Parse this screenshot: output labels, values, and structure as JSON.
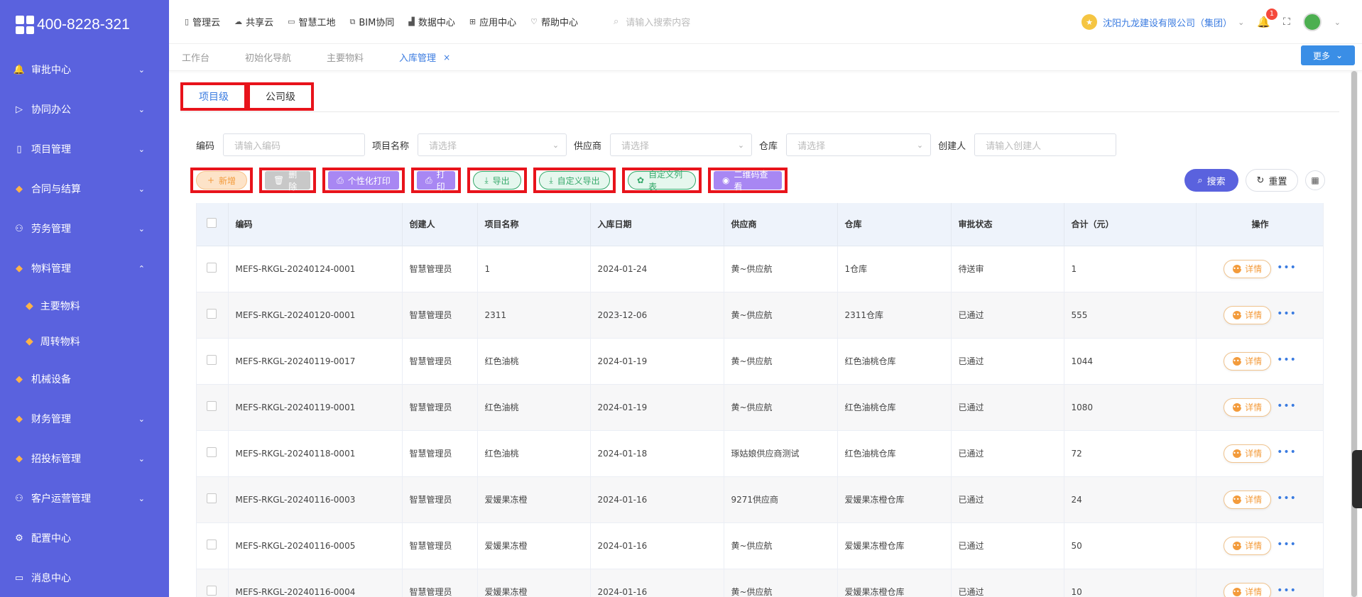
{
  "logo": {
    "text": "400-8228-321"
  },
  "sidebar": {
    "items": [
      {
        "icon": "bell-icon",
        "glyph": "🔔",
        "label": "审批中心",
        "chev": "⌄"
      },
      {
        "icon": "send-icon",
        "glyph": "▷",
        "label": "协同办公",
        "chev": "⌄"
      },
      {
        "icon": "book-icon",
        "glyph": "▯",
        "label": "项目管理",
        "chev": "⌄"
      },
      {
        "icon": "diamond-icon",
        "glyph": "◆",
        "label": "合同与结算",
        "chev": "⌄"
      },
      {
        "icon": "user-icon",
        "glyph": "⚇",
        "label": "劳务管理",
        "chev": "⌄"
      },
      {
        "icon": "diamond-icon",
        "glyph": "◆",
        "label": "物料管理",
        "chev": "⌃"
      }
    ],
    "sub_items": [
      {
        "icon": "diamond-icon",
        "glyph": "◆",
        "label": "主要物料"
      },
      {
        "icon": "diamond-icon",
        "glyph": "◆",
        "label": "周转物料"
      }
    ],
    "items_after": [
      {
        "icon": "diamond-icon",
        "glyph": "◆",
        "label": "机械设备",
        "chev": ""
      },
      {
        "icon": "diamond-icon",
        "glyph": "◆",
        "label": "财务管理",
        "chev": "⌄"
      },
      {
        "icon": "diamond-icon",
        "glyph": "◆",
        "label": "招投标管理",
        "chev": "⌄"
      },
      {
        "icon": "user-icon",
        "glyph": "⚇",
        "label": "客户运营管理",
        "chev": "⌄"
      },
      {
        "icon": "gear-icon",
        "glyph": "⚙",
        "label": "配置中心",
        "chev": ""
      },
      {
        "icon": "message-icon",
        "glyph": "▭",
        "label": "消息中心",
        "chev": ""
      }
    ]
  },
  "topnav": [
    {
      "icon": "book-icon",
      "glyph": "▯",
      "label": "管理云"
    },
    {
      "icon": "cloud-icon",
      "glyph": "☁",
      "label": "共享云"
    },
    {
      "icon": "monitor-icon",
      "glyph": "▭",
      "label": "智慧工地"
    },
    {
      "icon": "building-icon",
      "glyph": "⧉",
      "label": "BIM协同"
    },
    {
      "icon": "chart-icon",
      "glyph": "▟",
      "label": "数据中心"
    },
    {
      "icon": "apps-icon",
      "glyph": "⊞",
      "label": "应用中心"
    },
    {
      "icon": "help-icon",
      "glyph": "♡",
      "label": "帮助中心"
    }
  ],
  "top_search": {
    "placeholder": "请输入搜索内容"
  },
  "header": {
    "company": "沈阳九龙建设有限公司（集团）",
    "notification_count": "1"
  },
  "tabs": [
    {
      "label": "工作台",
      "active": false
    },
    {
      "label": "初始化导航",
      "active": false
    },
    {
      "label": "主要物料",
      "active": false
    },
    {
      "label": "入库管理",
      "active": true,
      "close": "×"
    }
  ],
  "more_button": "更多",
  "level_tabs": [
    "项目级",
    "公司级"
  ],
  "filters": {
    "code_label": "编码",
    "code_placeholder": "请输入编码",
    "project_label": "项目名称",
    "project_placeholder": "请选择",
    "supplier_label": "供应商",
    "supplier_placeholder": "请选择",
    "warehouse_label": "仓库",
    "warehouse_placeholder": "请选择",
    "creator_label": "创建人",
    "creator_placeholder": "请输入创建人"
  },
  "actions": {
    "new": "新增",
    "delete": "删除",
    "custom_print": "个性化打印",
    "print": "打印",
    "export": "导出",
    "custom_export": "自定义导出",
    "custom_list": "自定义列表",
    "qr_view": "二维码查看"
  },
  "search_button": "搜索",
  "reset_button": "重置",
  "table": {
    "columns": [
      "编码",
      "创建人",
      "项目名称",
      "入库日期",
      "供应商",
      "仓库",
      "审批状态",
      "合计（元）",
      "操作"
    ],
    "detail_label": "详情",
    "rows": [
      {
        "code": "MEFS-RKGL-20240124-0001",
        "creator": "智慧管理员",
        "project": "1",
        "date": "2024-01-24",
        "supplier": "黄~供应航",
        "warehouse": "1仓库",
        "status": "待送审",
        "total": "1"
      },
      {
        "code": "MEFS-RKGL-20240120-0001",
        "creator": "智慧管理员",
        "project": "2311",
        "date": "2023-12-06",
        "supplier": "黄~供应航",
        "warehouse": "2311仓库",
        "status": "已通过",
        "total": "555"
      },
      {
        "code": "MEFS-RKGL-20240119-0017",
        "creator": "智慧管理员",
        "project": "红色油桃",
        "date": "2024-01-19",
        "supplier": "黄~供应航",
        "warehouse": "红色油桃仓库",
        "status": "已通过",
        "total": "1044"
      },
      {
        "code": "MEFS-RKGL-20240119-0001",
        "creator": "智慧管理员",
        "project": "红色油桃",
        "date": "2024-01-19",
        "supplier": "黄~供应航",
        "warehouse": "红色油桃仓库",
        "status": "已通过",
        "total": "1080"
      },
      {
        "code": "MEFS-RKGL-20240118-0001",
        "creator": "智慧管理员",
        "project": "红色油桃",
        "date": "2024-01-18",
        "supplier": "琢姑娘供应商测试",
        "warehouse": "红色油桃仓库",
        "status": "已通过",
        "total": "72"
      },
      {
        "code": "MEFS-RKGL-20240116-0003",
        "creator": "智慧管理员",
        "project": "爱媛果冻橙",
        "date": "2024-01-16",
        "supplier": "9271供应商",
        "warehouse": "爱媛果冻橙仓库",
        "status": "已通过",
        "total": "24"
      },
      {
        "code": "MEFS-RKGL-20240116-0005",
        "creator": "智慧管理员",
        "project": "爱媛果冻橙",
        "date": "2024-01-16",
        "supplier": "黄~供应航",
        "warehouse": "爱媛果冻橙仓库",
        "status": "已通过",
        "total": "50"
      },
      {
        "code": "MEFS-RKGL-20240116-0004",
        "creator": "智慧管理员",
        "project": "爱媛果冻橙",
        "date": "2024-01-16",
        "supplier": "黄~供应航",
        "warehouse": "爱媛果冻橙仓库",
        "status": "已通过",
        "total": "10"
      }
    ]
  }
}
